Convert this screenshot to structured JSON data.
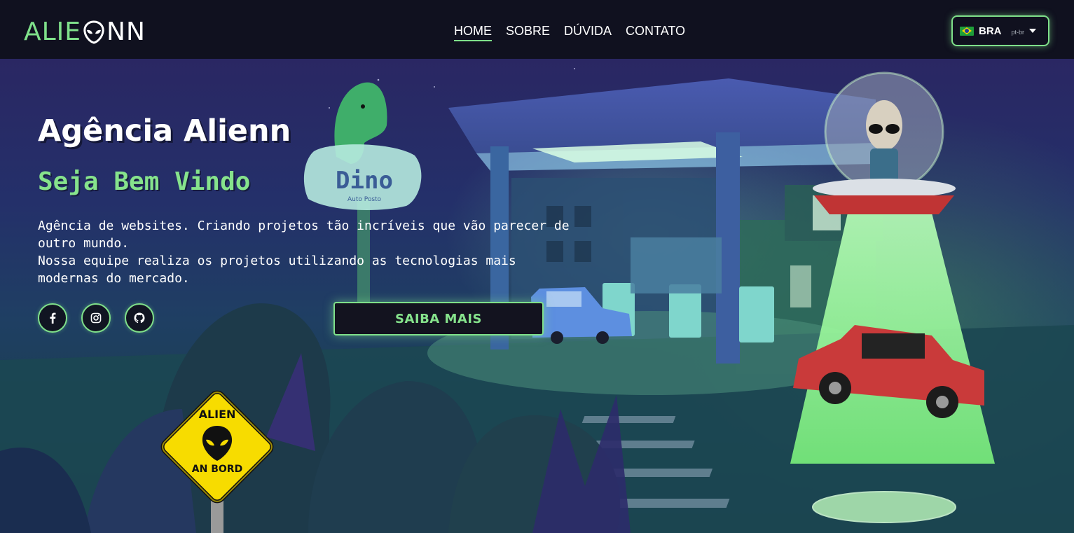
{
  "logo": {
    "part1": "ALIE",
    "part2": "NN",
    "icon": "alien-head-icon"
  },
  "nav": {
    "links": [
      {
        "label": "HOME",
        "active": true
      },
      {
        "label": "SOBRE",
        "active": false
      },
      {
        "label": "DÚVIDA",
        "active": false
      },
      {
        "label": "CONTATO",
        "active": false
      }
    ]
  },
  "language": {
    "code": "BRA",
    "sub": "pt-br",
    "flag": "brazil-flag-icon"
  },
  "hero": {
    "title": "Agência Alienn",
    "subtitle": "Seja Bem Vindo",
    "text_line1": "Agência de websites. Criando projetos tão incríveis que vão parecer de outro mundo.",
    "text_line2": "Nossa equipe realiza os projetos utilizando as tecnologias mais modernas do mercado.",
    "cta_label": "SAIBA MAIS",
    "socials": [
      "facebook-icon",
      "instagram-icon",
      "github-icon"
    ]
  },
  "scene": {
    "dino_sign": "Dino",
    "dino_sub": "Auto Posto",
    "road_sign_top": "ALIEN",
    "road_sign_bottom": "AN BORD"
  },
  "colors": {
    "accent": "#7fe08a",
    "nav_bg": "#10111f",
    "sign_yellow": "#f7dc00"
  }
}
